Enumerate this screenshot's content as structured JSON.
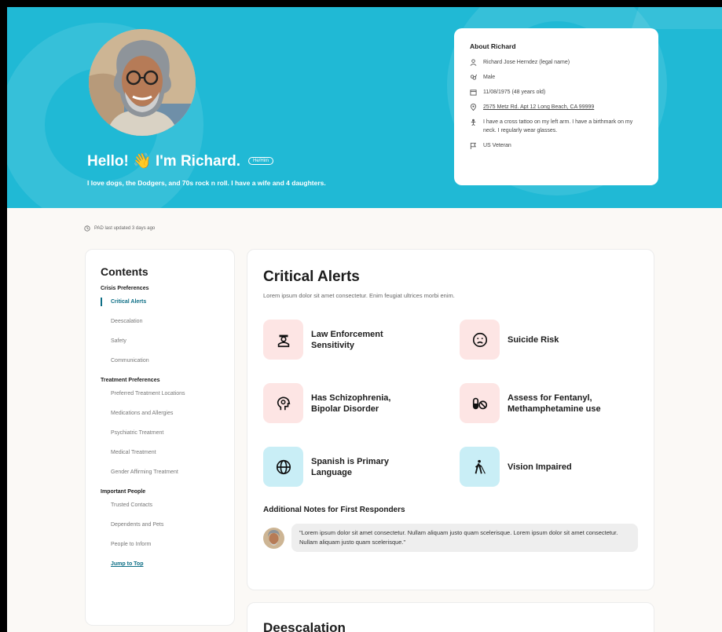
{
  "hero": {
    "greeting": "Hello! 👋 I'm Richard.",
    "pronouns": "He/Him",
    "bio": "I love dogs, the Dodgers, and 70s rock n roll. I have a wife and 4 daughters."
  },
  "about": {
    "title": "About Richard",
    "name": "Richard Jose Herndez (legal name)",
    "gender": "Male",
    "dob": "11/08/1975 (48 years old)",
    "address": "2575 Metz Rd. Apt 12 Long Beach, CA 99999",
    "description": "I have a cross tattoo on my left arm. I have a birthmark on my neck. I regularly wear glasses.",
    "veteran": "US Veteran"
  },
  "updated": "PAD last updated 3 days ago",
  "toc": {
    "title": "Contents",
    "sections": [
      {
        "label": "Crisis Preferences",
        "items": [
          "Critical Alerts",
          "Deescalation",
          "Safety",
          "Communication"
        ]
      },
      {
        "label": "Treatment Preferences",
        "items": [
          "Preferred Treatment Locations",
          "Medications and Allergies",
          "Psychiatric Treatment",
          "Medical Treatment",
          "Gender Affirming Treatment"
        ]
      },
      {
        "label": "Important People",
        "items": [
          "Trusted Contacts",
          "Dependents and Pets",
          "People to Inform"
        ]
      }
    ],
    "jump": "Jump to Top"
  },
  "alerts": {
    "title": "Critical Alerts",
    "description": "Lorem ipsum dolor sit amet consectetur. Enim feugiat ultrices morbi enim.",
    "items": [
      {
        "label": "Law Enforcement Sensitivity",
        "icon": "police-officer-icon",
        "color": "#fde5e4"
      },
      {
        "label": "Suicide Risk",
        "icon": "sad-face-icon",
        "color": "#fde5e4"
      },
      {
        "label": "Has Schizophrenia, Bipolar Disorder",
        "icon": "head-brain-icon",
        "color": "#fde5e4"
      },
      {
        "label": "Assess for Fentanyl, Methamphetamine use",
        "icon": "no-pills-icon",
        "color": "#fde5e4"
      },
      {
        "label": "Spanish is Primary Language",
        "icon": "globe-icon",
        "color": "#c9eef6"
      },
      {
        "label": "Vision Impaired",
        "icon": "blind-person-icon",
        "color": "#c9eef6"
      }
    ],
    "notes_title": "Additional Notes for First Responders",
    "note": "\"Lorem ipsum dolor sit amet consectetur. Nullam aliquam justo quam scelerisque. Lorem ipsum dolor sit amet consectetur. Nullam aliquam justo quam scelerisque.\""
  },
  "deescalation": {
    "title": "Deescalation"
  },
  "colors": {
    "hero": "#20b9d5",
    "accent": "#0e6f86",
    "alert_pink": "#fde5e4",
    "alert_blue": "#c9eef6"
  }
}
